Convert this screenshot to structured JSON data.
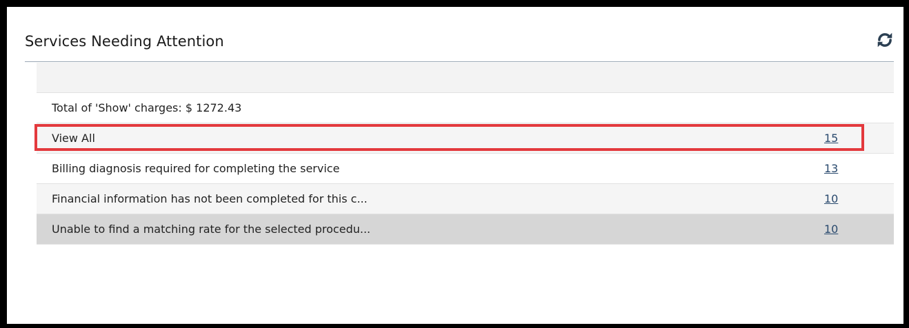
{
  "widget": {
    "title": "Services Needing Attention",
    "refresh_icon": "refresh-icon"
  },
  "summary": {
    "total_label": "Total of 'Show' charges: $ 1272.43"
  },
  "rows": [
    {
      "label": "View All",
      "count": "15"
    },
    {
      "label": "Billing diagnosis required for completing the service",
      "count": "13"
    },
    {
      "label": "Financial information has not been completed for this c...",
      "count": "10"
    },
    {
      "label": "Unable to find a matching rate for the selected procedu...",
      "count": "10"
    }
  ],
  "colors": {
    "highlight": "#e3393d",
    "link": "#2a4a6e",
    "selected_row": "#d6d6d6"
  }
}
